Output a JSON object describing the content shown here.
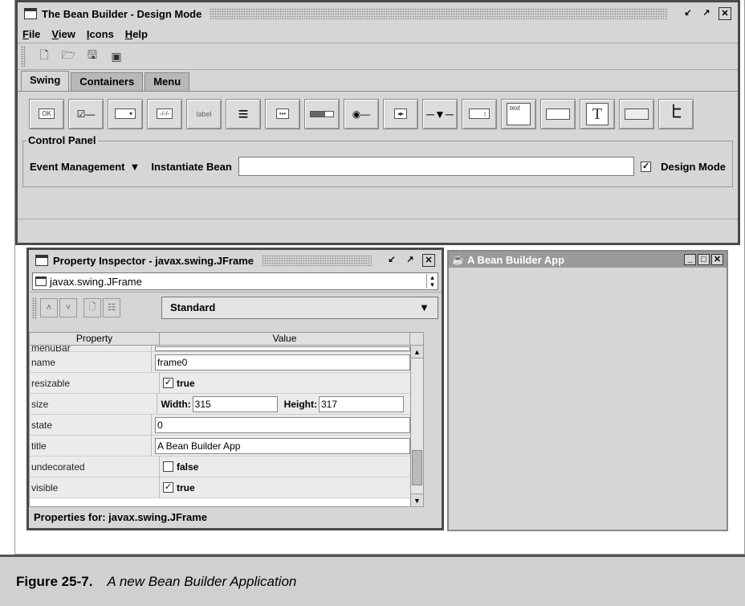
{
  "main_window": {
    "title": "The Bean Builder - Design Mode",
    "controls": [
      "minimize",
      "restore",
      "close"
    ],
    "menu": [
      "File",
      "View",
      "Icons",
      "Help"
    ],
    "toolbar_icons": [
      "new-icon",
      "open-icon",
      "save-icon",
      "preview-icon"
    ],
    "tabs": [
      {
        "label": "Swing",
        "active": true
      },
      {
        "label": "Containers",
        "active": false
      },
      {
        "label": "Menu",
        "active": false
      }
    ],
    "palette": [
      {
        "name": "button",
        "text": "OK"
      },
      {
        "name": "checkbox",
        "text": "☑—"
      },
      {
        "name": "combobox",
        "text": "▾"
      },
      {
        "name": "formatted-text-field",
        "text": "-/-/-"
      },
      {
        "name": "label",
        "text": "label"
      },
      {
        "name": "list",
        "text": "≡"
      },
      {
        "name": "password-field",
        "text": "•••"
      },
      {
        "name": "progress-bar",
        "text": ""
      },
      {
        "name": "radio-button",
        "text": "◉—"
      },
      {
        "name": "scrollbar",
        "text": "◂▸"
      },
      {
        "name": "slider",
        "text": ""
      },
      {
        "name": "spinner",
        "text": "↕"
      },
      {
        "name": "text-area",
        "text": "text"
      },
      {
        "name": "text-field",
        "text": ""
      },
      {
        "name": "text-pane",
        "text": "T"
      },
      {
        "name": "toggle-button",
        "text": ""
      },
      {
        "name": "tree",
        "text": ""
      }
    ],
    "control_panel": {
      "legend": "Control Panel",
      "dropdown": "Event Management",
      "instantiate_label": "Instantiate Bean",
      "instantiate_value": "",
      "design_mode_label": "Design Mode",
      "design_mode_checked": true
    }
  },
  "property_inspector": {
    "title": "Property Inspector - javax.swing.JFrame",
    "selector": "javax.swing.JFrame",
    "view_mode": "Standard",
    "columns": [
      "Property",
      "Value"
    ],
    "rows": [
      {
        "name": "menuBar",
        "type": "field",
        "value": ""
      },
      {
        "name": "name",
        "type": "field",
        "value": "frame0"
      },
      {
        "name": "resizable",
        "type": "check",
        "value": "true",
        "checked": true
      },
      {
        "name": "size",
        "type": "size",
        "width_label": "Width:",
        "width": "315",
        "height_label": "Height:",
        "height": "317"
      },
      {
        "name": "state",
        "type": "field",
        "value": "0"
      },
      {
        "name": "title",
        "type": "field",
        "value": "A Bean Builder App"
      },
      {
        "name": "undecorated",
        "type": "check",
        "value": "false",
        "checked": false
      },
      {
        "name": "visible",
        "type": "check",
        "value": "true",
        "checked": true
      }
    ],
    "footer": "Properties for:  javax.swing.JFrame"
  },
  "app_window": {
    "title": "A Bean Builder App",
    "controls": [
      "_",
      "□",
      "✕"
    ]
  },
  "caption": {
    "figure": "Figure 25-7.",
    "text": "A new Bean Builder Application"
  }
}
